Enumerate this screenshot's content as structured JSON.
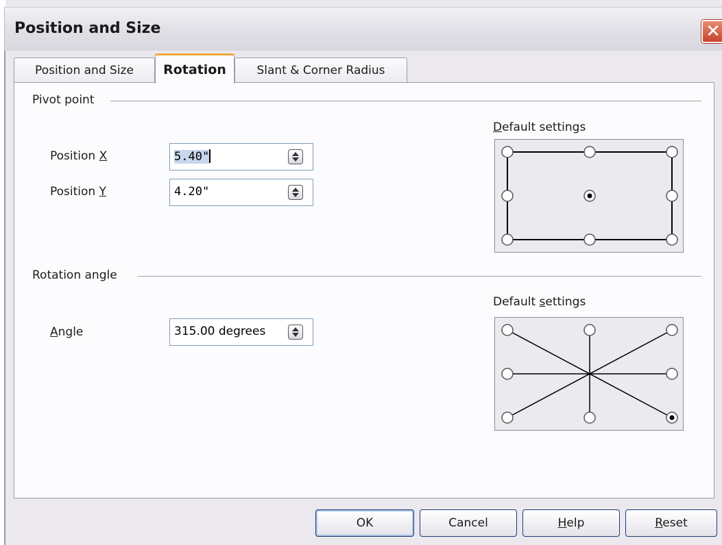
{
  "window": {
    "title": "Position and Size"
  },
  "tabs": [
    {
      "label": "Position and Size"
    },
    {
      "label": "Rotation"
    },
    {
      "label": "Slant & Corner Radius"
    }
  ],
  "pivot": {
    "section_label": "Pivot point",
    "position_x": {
      "label_pre": "Position ",
      "label_u": "X",
      "value": "5.40\""
    },
    "position_y": {
      "label_pre": "Position ",
      "label_u": "Y",
      "value": "4.20\""
    },
    "default_settings": {
      "label_u": "D",
      "label_post": "efault settings"
    }
  },
  "rotation": {
    "section_label": "Rotation angle",
    "angle": {
      "label_u": "A",
      "label_post": "ngle",
      "value": "315.00 degrees"
    },
    "default_settings": {
      "label_pre": "Default ",
      "label_u": "s",
      "label_post": "ettings"
    }
  },
  "buttons": {
    "ok": "OK",
    "cancel": "Cancel",
    "help_u": "H",
    "help_post": "elp",
    "reset_u": "R",
    "reset_post": "eset"
  }
}
